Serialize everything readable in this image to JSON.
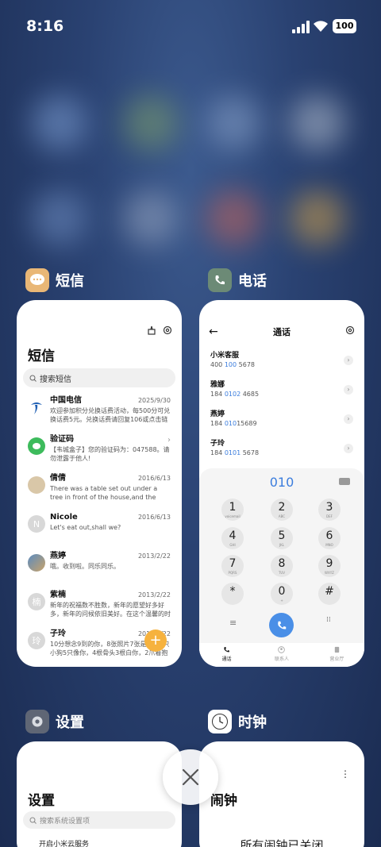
{
  "status_bar": {
    "time": "8:16",
    "battery": "100"
  },
  "apps": {
    "messages": {
      "app_name": "短信",
      "screen_title": "短信",
      "search_placeholder": "搜索短信",
      "conversations": [
        {
          "name": "中国电信",
          "date": "2025/9/30",
          "preview": "欢迎参加积分兑换话费活动，每500分可兑换话费5元。兑换话费请回复106或点击链接话费..."
        },
        {
          "name": "验证码",
          "date": "",
          "preview": "【韦城盒子】您的验证码为：047588。请勿泄露于他人!"
        },
        {
          "name": "倩倩",
          "date": "2016/6/13",
          "preview": "There was a table set out under a tree in front of the house,and the March Hare an..."
        },
        {
          "name": "Nicole",
          "date": "2016/6/13",
          "preview": "Let's eat out,shall we?"
        },
        {
          "name": "燕婷",
          "date": "2013/2/22",
          "preview": "哦。收到啦。同乐同乐。"
        },
        {
          "name": "紫楠",
          "date": "2013/2/22",
          "preview": "新年的祝福数不胜数，新年的愿望好多好多，新年的问候依旧美好。在这个温馨的时刻，..."
        },
        {
          "name": "子玲",
          "date": "2013/2/22",
          "preview": "10分想念9到的你，8张照片7张是你，6只小狗5只像你，4根骨头3根白你，2爪着抱1百..."
        }
      ],
      "avatar_letters": [
        "N",
        "楠",
        "玲"
      ]
    },
    "phone": {
      "app_name": "电话",
      "screen_title": "通话",
      "contacts": [
        {
          "name": "小米客服",
          "num_pre": "400 ",
          "num_hl": "100",
          "num_post": " 5678"
        },
        {
          "name": "雅娜",
          "num_pre": "184 ",
          "num_hl": "0102",
          "num_post": " 4685"
        },
        {
          "name": "燕婷",
          "num_pre": "184 ",
          "num_hl": "010",
          "num_post": "15689"
        },
        {
          "name": "子玲",
          "num_pre": "184 ",
          "num_hl": "0101",
          "num_post": " 5678"
        }
      ],
      "dialed_number": "010",
      "keys": [
        {
          "d": "1",
          "l": "voicemail"
        },
        {
          "d": "2",
          "l": "ABC"
        },
        {
          "d": "3",
          "l": "DEF"
        },
        {
          "d": "4",
          "l": "GHI"
        },
        {
          "d": "5",
          "l": "JKL"
        },
        {
          "d": "6",
          "l": "MNO"
        },
        {
          "d": "7",
          "l": "PQRS"
        },
        {
          "d": "8",
          "l": "TUV"
        },
        {
          "d": "9",
          "l": "WXYZ"
        },
        {
          "d": "*",
          "l": ""
        },
        {
          "d": "0",
          "l": "+"
        },
        {
          "d": "#",
          "l": ""
        }
      ],
      "tabs": [
        "通话",
        "联系人",
        "营业厅"
      ]
    },
    "settings": {
      "app_name": "设置",
      "screen_title": "设置",
      "search_placeholder": "搜索系统设置项",
      "first_item": "开启小米云服务"
    },
    "clock": {
      "app_name": "时钟",
      "screen_title": "闹钟",
      "status": "所有闹钟已关闭"
    }
  },
  "colors": {
    "messages_icon": "#e9b776",
    "phone_icon": "#6c8a76",
    "settings_icon": "#5f6675",
    "dial_highlight": "#3b7ddd",
    "fab": "#f6b23e"
  }
}
